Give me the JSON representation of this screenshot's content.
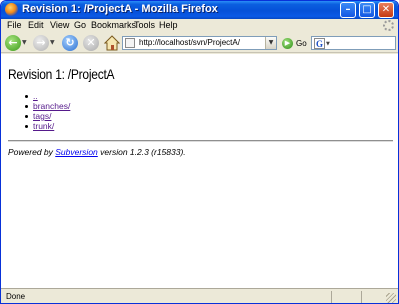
{
  "window": {
    "title": "Revision 1: /ProjectA - Mozilla Firefox",
    "controls": {
      "minimize": "–",
      "maximize": "□",
      "close": "✕"
    }
  },
  "menu": [
    "File",
    "Edit",
    "View",
    "Go",
    "Bookmarks",
    "Tools",
    "Help"
  ],
  "toolbar": {
    "back_glyph": "←",
    "forward_glyph": "→",
    "reload_glyph": "↻",
    "stop_glyph": "✕",
    "dropdown_glyph": "▼",
    "url": "http://localhost/svn/ProjectA/",
    "go_label": "Go",
    "search_engine_glyph": "G"
  },
  "page": {
    "title": "Revision 1: /ProjectA",
    "entries": [
      "..",
      "branches/",
      "tags/",
      "trunk/"
    ],
    "footer_prefix": "Powered by ",
    "footer_link": "Subversion",
    "footer_suffix": " version 1.2.3 (r15833)."
  },
  "status": {
    "text": "Done"
  },
  "colors": {
    "titlebar": "#0550d8",
    "chrome": "#ece9d8",
    "visited_link": "#551a8b",
    "link": "#0000ee"
  }
}
